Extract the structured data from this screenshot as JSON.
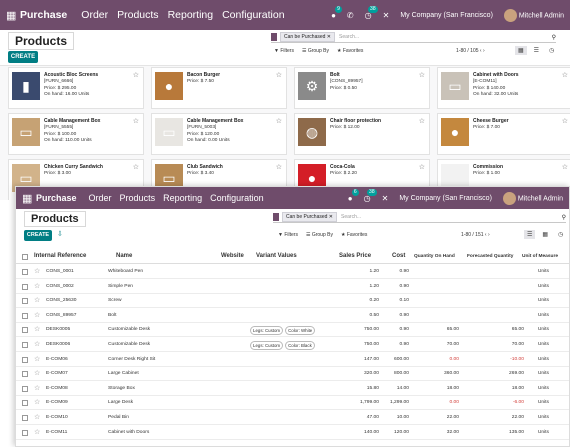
{
  "back": {
    "nav": {
      "brand": "Purchase",
      "menus": [
        "Order",
        "Products",
        "Reporting",
        "Configuration"
      ],
      "company": "My Company (San Francisco)",
      "user": "Mitchell Admin",
      "chat_count": "9",
      "activity_count": "38"
    },
    "title": "Products",
    "create_label": "CREATE",
    "search": {
      "facet": "Can be Purchased",
      "placeholder": "Search..."
    },
    "filters": [
      "Filters",
      "Group By",
      "Favorites"
    ],
    "pager": "1-80 / 105",
    "cards": [
      {
        "name": "Acoustic Bloc Screens",
        "ref": "[FURN_6666]",
        "price": "Price: $ 295.00",
        "onhand": "On hand: 16.00 Units"
      },
      {
        "name": "Bacon Burger",
        "ref": "",
        "price": "Price: $ 7.50",
        "onhand": ""
      },
      {
        "name": "Bolt",
        "ref": "[CONS_89957]",
        "price": "Price: $ 0.50",
        "onhand": ""
      },
      {
        "name": "Cabinet with Doors",
        "ref": "[E-COM11]",
        "price": "Price: $ 140.00",
        "onhand": "On hand: 32.00 Units"
      },
      {
        "name": "Cable Management Box",
        "ref": "[FURN_5555]",
        "price": "Price: $ 100.00",
        "onhand": "On hand: 110.00 Units"
      },
      {
        "name": "Cable Management Box",
        "ref": "[FURN_5003]",
        "price": "Price: $ 120.00",
        "onhand": "On hand: 0.00 Units"
      },
      {
        "name": "Chair floor protection",
        "ref": "",
        "price": "Price: $ 12.00",
        "onhand": ""
      },
      {
        "name": "Cheese Burger",
        "ref": "",
        "price": "Price: $ 7.00",
        "onhand": ""
      },
      {
        "name": "Chicken Curry Sandwich",
        "ref": "",
        "price": "Price: $ 3.00",
        "onhand": ""
      },
      {
        "name": "Club Sandwich",
        "ref": "",
        "price": "Price: $ 3.40",
        "onhand": ""
      },
      {
        "name": "Coca-Cola",
        "ref": "",
        "price": "Price: $ 2.20",
        "onhand": ""
      },
      {
        "name": "Commission",
        "ref": "",
        "price": "Price: $ 1.00",
        "onhand": ""
      }
    ]
  },
  "front": {
    "nav": {
      "brand": "Purchase",
      "menus": [
        "Order",
        "Products",
        "Reporting",
        "Configuration"
      ],
      "company": "My Company (San Francisco)",
      "user": "Mitchell Admin",
      "chat_count": "6",
      "activity_count": "38"
    },
    "title": "Products",
    "create_label": "CREATE",
    "search": {
      "facet": "Can be Purchased",
      "placeholder": "Search..."
    },
    "filters": [
      "Filters",
      "Group By",
      "Favorites"
    ],
    "pager": "1-80 / 151",
    "columns": [
      "Internal Reference",
      "Name",
      "Website",
      "Variant Values",
      "Sales Price",
      "Cost",
      "Quantity On Hand",
      "Forecasted Quantity",
      "Unit of Measure"
    ],
    "rows": [
      {
        "ref": "CONS_0001",
        "name": "Whiteboard Pen",
        "variants": [],
        "price": "1.20",
        "cost": "0.90",
        "onhand": "",
        "forecast": "",
        "uom": "Units",
        "neg": false
      },
      {
        "ref": "CONS_0002",
        "name": "Simple Pen",
        "variants": [],
        "price": "1.20",
        "cost": "0.90",
        "onhand": "",
        "forecast": "",
        "uom": "Units",
        "neg": false
      },
      {
        "ref": "CONS_25630",
        "name": "Screw",
        "variants": [],
        "price": "0.20",
        "cost": "0.10",
        "onhand": "",
        "forecast": "",
        "uom": "Units",
        "neg": false
      },
      {
        "ref": "CONS_89957",
        "name": "Bolt",
        "variants": [],
        "price": "0.50",
        "cost": "0.90",
        "onhand": "",
        "forecast": "",
        "uom": "Units",
        "neg": false
      },
      {
        "ref": "DESK0005",
        "name": "Customizable Desk",
        "variants": [
          "Legs: Custom",
          "Color: White"
        ],
        "price": "750.00",
        "cost": "0.90",
        "onhand": "65.00",
        "forecast": "65.00",
        "uom": "Units",
        "neg": false
      },
      {
        "ref": "DESK0006",
        "name": "Customizable Desk",
        "variants": [
          "Legs: Custom",
          "Color: Black"
        ],
        "price": "750.00",
        "cost": "0.90",
        "onhand": "70.00",
        "forecast": "70.00",
        "uom": "Units",
        "neg": false
      },
      {
        "ref": "E-COM06",
        "name": "Corner Desk Right Sit",
        "variants": [],
        "price": "147.00",
        "cost": "600.00",
        "onhand": "0.00",
        "forecast": "-10.00",
        "uom": "Units",
        "neg": true
      },
      {
        "ref": "E-COM07",
        "name": "Large Cabinet",
        "variants": [],
        "price": "320.00",
        "cost": "800.00",
        "onhand": "360.00",
        "forecast": "269.00",
        "uom": "Units",
        "neg": false
      },
      {
        "ref": "E-COM08",
        "name": "Storage Box",
        "variants": [],
        "price": "15.80",
        "cost": "14.00",
        "onhand": "18.00",
        "forecast": "18.00",
        "uom": "Units",
        "neg": false
      },
      {
        "ref": "E-COM09",
        "name": "Large Desk",
        "variants": [],
        "price": "1,799.00",
        "cost": "1,299.00",
        "onhand": "0.00",
        "forecast": "-6.00",
        "uom": "Units",
        "neg": true
      },
      {
        "ref": "E-COM10",
        "name": "Pedal Bin",
        "variants": [],
        "price": "47.00",
        "cost": "10.00",
        "onhand": "22.00",
        "forecast": "22.00",
        "uom": "Units",
        "neg": false
      },
      {
        "ref": "E-COM11",
        "name": "Cabinet with Doors",
        "variants": [],
        "price": "140.00",
        "cost": "120.00",
        "onhand": "32.00",
        "forecast": "135.00",
        "uom": "Units",
        "neg": false
      }
    ]
  },
  "colors": {
    "brand": "#6f4c6b",
    "create": "#017e84",
    "negative": "#d23f3a"
  }
}
